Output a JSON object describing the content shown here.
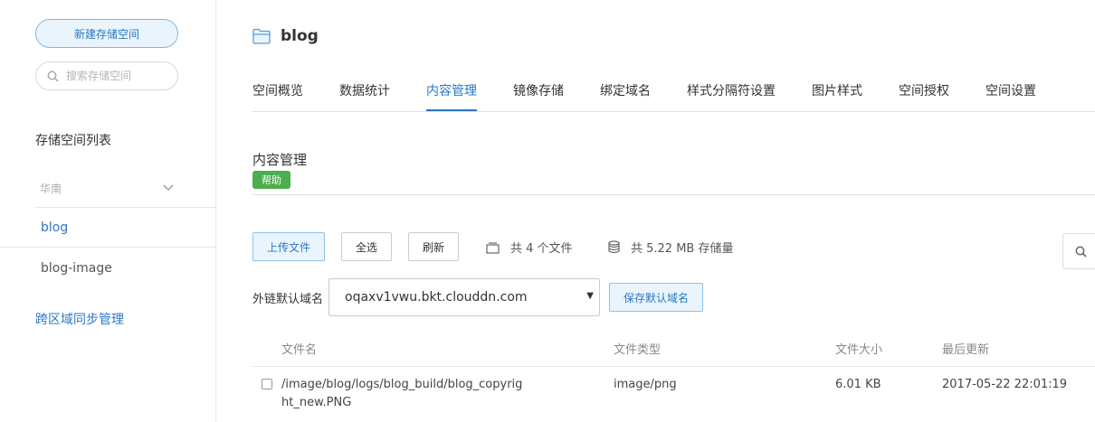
{
  "sidebar": {
    "new_bucket_label": "新建存储空间",
    "search_placeholder": "搜索存储空间",
    "list_title": "存储空间列表",
    "region_label": "华南",
    "buckets": [
      {
        "label": "blog",
        "active": true
      },
      {
        "label": "blog-image",
        "active": false
      }
    ],
    "cross_region_label": "跨区域同步管理"
  },
  "header": {
    "bucket_name": "blog",
    "icon": "folder-icon"
  },
  "tabs": [
    {
      "label": "空间概览"
    },
    {
      "label": "数据统计"
    },
    {
      "label": "内容管理",
      "active": true
    },
    {
      "label": "镜像存储"
    },
    {
      "label": "绑定域名"
    },
    {
      "label": "样式分隔符设置"
    },
    {
      "label": "图片样式"
    },
    {
      "label": "空间授权"
    },
    {
      "label": "空间设置"
    }
  ],
  "content": {
    "section_title": "内容管理",
    "help_label": "帮助",
    "toolbar": {
      "upload_label": "上传文件",
      "select_all_label": "全选",
      "refresh_label": "刷新",
      "file_count_text": "共 4 个文件",
      "storage_text": "共 5.22 MB 存储量"
    },
    "domain": {
      "label": "外链默认域名",
      "selected": "oqaxv1vwu.bkt.clouddn.com",
      "save_label": "保存默认域名"
    },
    "table": {
      "headers": [
        "文件名",
        "文件类型",
        "文件大小",
        "最后更新"
      ],
      "rows": [
        {
          "name": "/image/blog/logs/blog_build/blog_copyright_new.PNG",
          "type": "image/png",
          "size": "6.01 KB",
          "updated": "2017-05-22 22:01:19"
        }
      ]
    }
  },
  "colors": {
    "accent": "#2a78c4",
    "help_badge": "#4cae4c"
  }
}
